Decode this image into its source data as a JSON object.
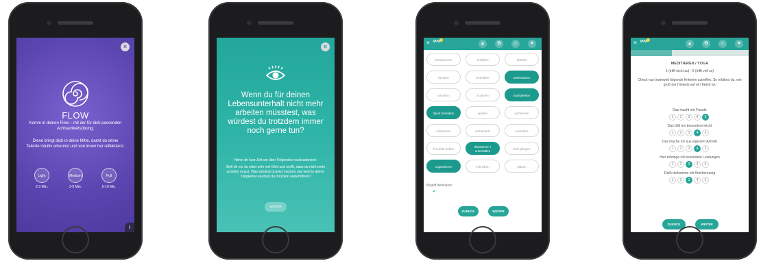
{
  "screen1": {
    "close": "×",
    "title": "FLOW",
    "subtitle": "Komm in deinen Flow – mit der für dich passenden Achtsamkeitsübung.",
    "description": "Diese bringt dich in deine Mitte, damit du deine Talente intuitiv erkennst und von innen her reflektierst.",
    "options": [
      {
        "label": "Light",
        "duration": "2-3 Min."
      },
      {
        "label": "Medium",
        "duration": "3-5 Min."
      },
      {
        "label": "Full",
        "duration": "5-10 Min."
      }
    ],
    "info": "i"
  },
  "screen2": {
    "close": "×",
    "question": "Wenn du für deinen Lebensunterhalt nicht mehr arbeiten müsstest, was würdest du trotzdem immer noch gerne tun?",
    "prompt": "Nimm dir kurz Zeit um über Folgendes nachzudenken:",
    "body": "Stell dir vor du erbst sehr viel Geld und weißt, dass du nicht mehr arbeiten musst. Was würdest du jetzt machen und welche deiner Tätigkeiten würdest du trotzdem weiterführen?",
    "button": "WEITER"
  },
  "app_header": {
    "menu": "≡",
    "logo": "gogo"
  },
  "screen3": {
    "chips": [
      {
        "label": "konstruieren",
        "selected": false
      },
      {
        "label": "erstellen",
        "selected": false
      },
      {
        "label": "basteln",
        "selected": false
      },
      {
        "label": "beraten",
        "selected": false
      },
      {
        "label": "betreiben",
        "selected": false
      },
      {
        "label": "unterstützen",
        "selected": true
      },
      {
        "label": "wandern",
        "selected": false
      },
      {
        "label": "erzählen",
        "selected": false
      },
      {
        "label": "nachdenken",
        "selected": true
      },
      {
        "label": "Sport betreiben",
        "selected": true
      },
      {
        "label": "spielen",
        "selected": false
      },
      {
        "label": "aufräumen",
        "selected": false
      },
      {
        "label": "einräumen",
        "selected": false
      },
      {
        "label": "verhandeln",
        "selected": false
      },
      {
        "label": "erwerben",
        "selected": false
      },
      {
        "label": "Freunde treffen",
        "selected": false
      },
      {
        "label": "diskutieren / unterhalten",
        "selected": true
      },
      {
        "label": "Sich pflegen",
        "selected": false
      },
      {
        "label": "organisieren",
        "selected": true
      },
      {
        "label": "schreiben",
        "selected": false
      },
      {
        "label": "planen",
        "selected": false
      }
    ],
    "define_label": "Begriff definieren",
    "check": "✔",
    "back": "ZURÜCK",
    "next": "WEITER"
  },
  "screen4": {
    "heading": "MEDITIEREN / YOGA",
    "scale": "1 (trifft nicht zu) - 5 (trifft voll zu)",
    "intro": "Check nun inwieweit folgende Kriterien zutreffen. So erfährst du, wie groß der Hinweis auf ein Talent ist.",
    "criteria": [
      {
        "label": "Das macht mir Freude",
        "value": 5
      },
      {
        "label": "Das fällt mir besonders leicht",
        "value": 4
      },
      {
        "label": "Das mache ich aus eigenem Antrieb",
        "value": 4
      },
      {
        "label": "Hier erbringe ich besondere Leistungen",
        "value": 3
      },
      {
        "label": "Dafür bekomme ich Anerkennung",
        "value": 3
      }
    ],
    "scale_values": [
      "1",
      "2",
      "3",
      "4",
      "5"
    ],
    "back": "ZURÜCK",
    "next": "WEITER"
  },
  "colors": {
    "purple": "#5b45b0",
    "teal": "#26a598",
    "teal_dark": "#1c9a8e"
  }
}
